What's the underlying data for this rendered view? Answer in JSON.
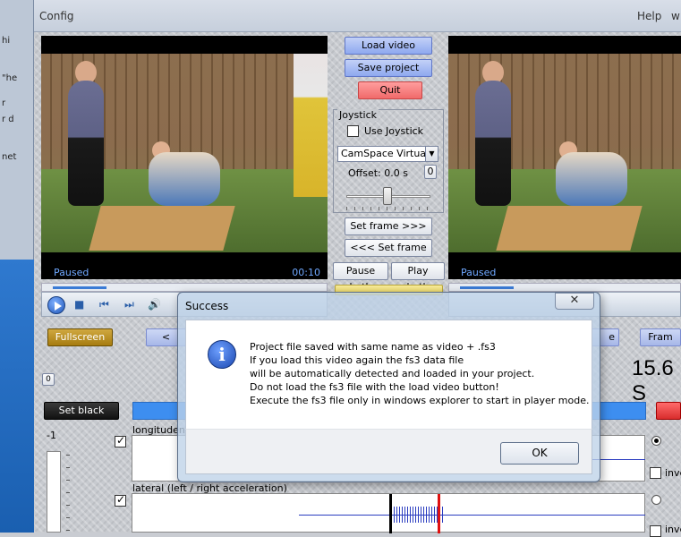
{
  "menubar": {
    "config": "Config",
    "help": "Help",
    "w": "w"
  },
  "bgwin": {
    "texts": [
      "hi",
      "\"he",
      "r",
      "r d",
      "net"
    ]
  },
  "left_video": {
    "status": "Paused",
    "time": "00:10"
  },
  "right_video": {
    "status": "Paused"
  },
  "center": {
    "load_video": "Load video",
    "save_project": "Save project",
    "quit": "Quit",
    "joystick_legend": "Joystick",
    "use_joystick": "Use Joystick",
    "joystick_device": "CamSpace Virtual ...",
    "offset_label": "Offset: 0.0 s",
    "offset_reset": "0",
    "set_frame_forward": "Set frame >>>",
    "set_frame_back": "<<< Set frame",
    "pause_both": "Pause both",
    "play_both": "Play both"
  },
  "lower": {
    "fullscreen": "Fullscreen",
    "left_nav": "<",
    "right_nav_e": "e",
    "frame_btn": "Fram",
    "zero_box": "0",
    "big_value": "15.6 S",
    "set_black": "Set black",
    "scale_top": "-1",
    "graph1_label": "longituden",
    "graph2_label": "lateral (left / right acceleration)",
    "invert1": "inve",
    "invert2": "inve"
  },
  "dialog": {
    "title": "Success",
    "lines": [
      "Project file saved with same name as video + .fs3",
      "If you load this video again the fs3 data file",
      "will be automatically detected and loaded in your project.",
      "Do not load the fs3 file with the load video button!",
      "Execute the fs3 file only in windows explorer to start in player mode."
    ],
    "ok": "OK",
    "close": "✕"
  },
  "colors": {
    "accent_blue": "#3a7bd5",
    "quit_red": "#f06a6a",
    "marker_red": "#e01010"
  }
}
